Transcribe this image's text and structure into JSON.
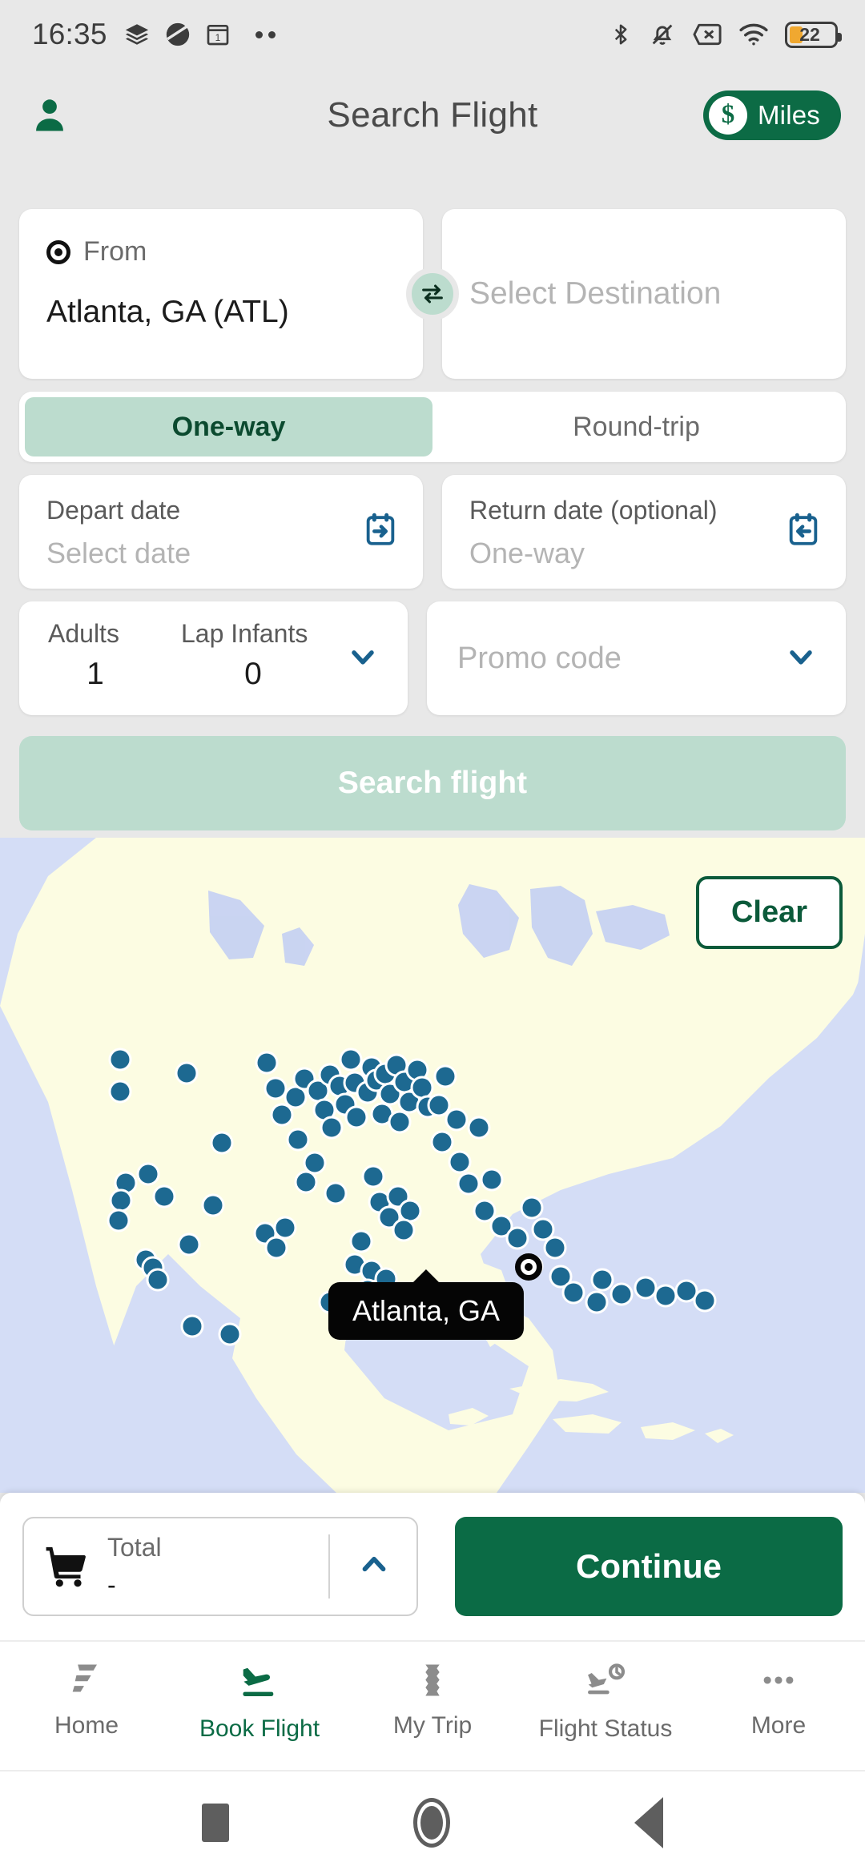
{
  "status_bar": {
    "time": "16:35",
    "battery_percent": "22",
    "left_icons": [
      "layers-icon",
      "globe-icon",
      "calendar-one-icon",
      "more-dots-icon"
    ],
    "right_icons": [
      "bluetooth-icon",
      "notifications-off-icon",
      "sim-card-missing-icon",
      "wifi-icon",
      "battery-icon"
    ]
  },
  "header": {
    "title": "Search Flight",
    "profile_icon": "person-icon",
    "miles_label": "Miles",
    "miles_currency": "$",
    "accent_green": "#0b6b45"
  },
  "search": {
    "origin": {
      "label": "From",
      "value": "Atlanta, GA (ATL)",
      "icon": "target-icon"
    },
    "destination": {
      "placeholder": "Select Destination"
    },
    "swap_icon": "swap-horizontal-icon",
    "trip_types": [
      {
        "label": "One-way",
        "selected": true
      },
      {
        "label": "Round-trip",
        "selected": false
      }
    ],
    "depart": {
      "label": "Depart date",
      "placeholder": "Select date",
      "icon": "calendar-depart-icon"
    },
    "return": {
      "label": "Return date (optional)",
      "placeholder": "One-way",
      "icon": "calendar-return-icon"
    },
    "passengers": {
      "adults_label": "Adults",
      "adults_value": "1",
      "infants_label": "Lap Infants",
      "infants_value": "0",
      "chevron_icon": "chevron-down-icon"
    },
    "promo": {
      "placeholder": "Promo code",
      "chevron_icon": "chevron-down-icon"
    },
    "submit_label": "Search flight"
  },
  "map": {
    "clear_label": "Clear",
    "selected_city_tooltip": "Atlanta, GA",
    "ocean_color": "#d4ddf6",
    "land_color": "#fcfce2",
    "airport_dot_color": "#1d6991"
  },
  "total_bar": {
    "cart_icon": "shopping-cart-icon",
    "label": "Total",
    "value": "-",
    "expand_icon": "chevron-up-icon",
    "continue_label": "Continue"
  },
  "bottom_nav": [
    {
      "label": "Home",
      "icon": "home-logo-icon",
      "active": false
    },
    {
      "label": "Book Flight",
      "icon": "plane-landing-icon",
      "active": true
    },
    {
      "label": "My Trip",
      "icon": "ticket-icon",
      "active": false
    },
    {
      "label": "Flight Status",
      "icon": "plane-clock-icon",
      "active": false
    },
    {
      "label": "More",
      "icon": "more-dots-icon",
      "active": false
    }
  ],
  "android_nav": [
    {
      "name": "recents-button",
      "icon": "square-icon"
    },
    {
      "name": "home-button",
      "icon": "circle-icon"
    },
    {
      "name": "back-button",
      "icon": "triangle-left-icon"
    }
  ]
}
